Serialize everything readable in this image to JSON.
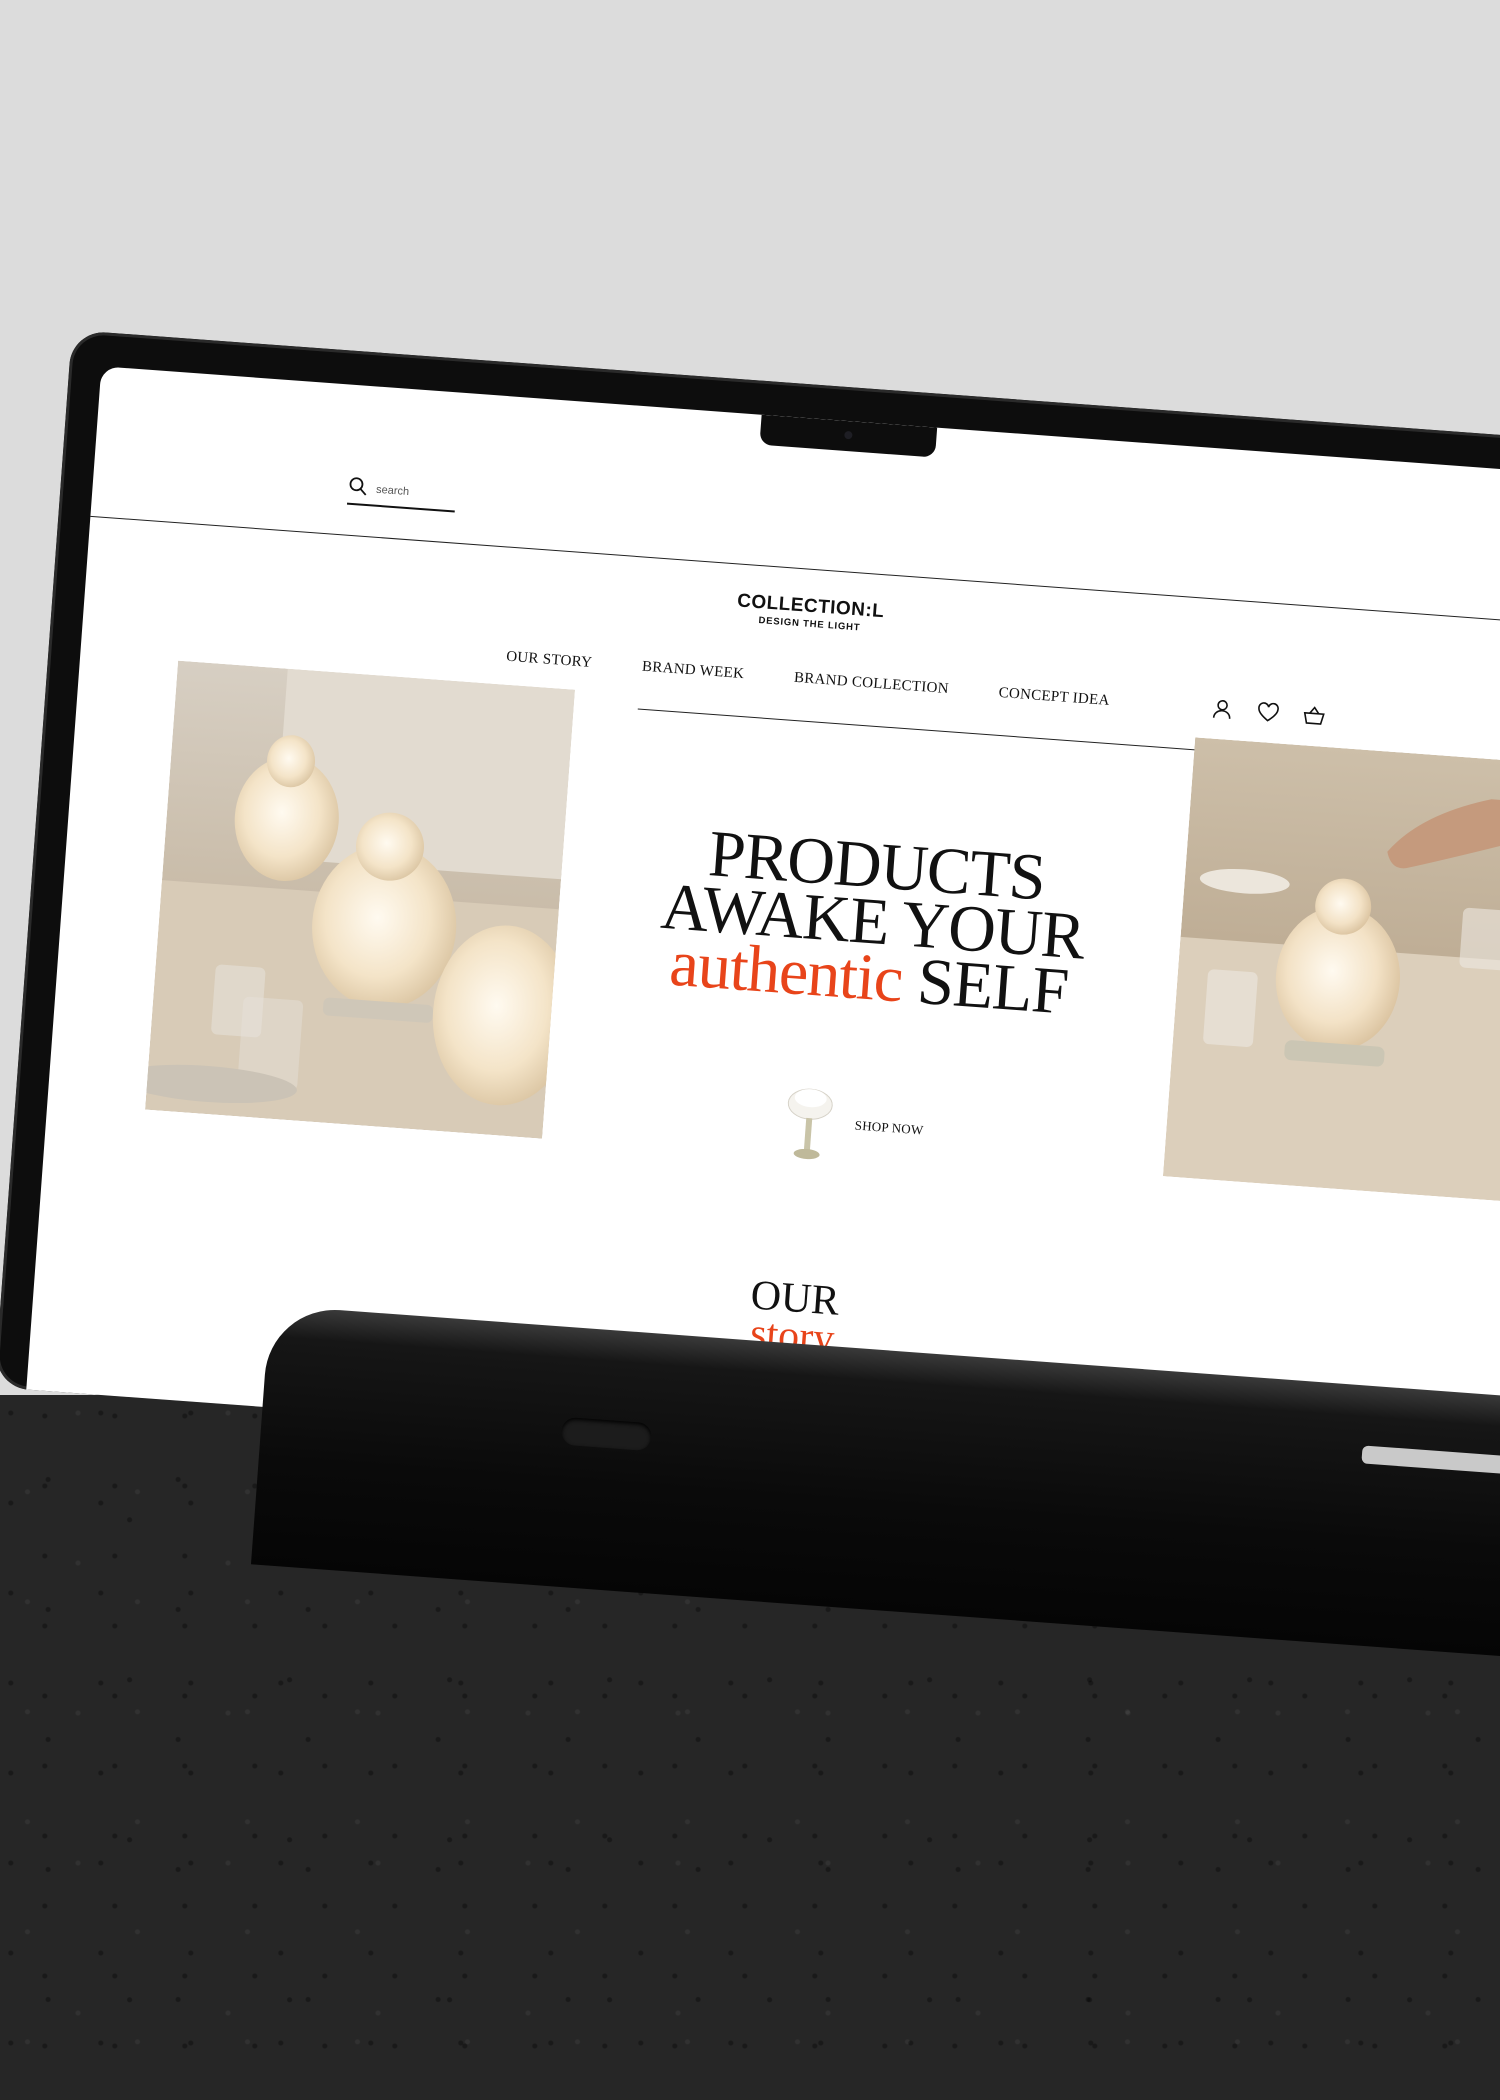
{
  "header": {
    "search_placeholder": "search",
    "logo_title": "COLLECTION:L",
    "logo_tagline": "DESIGN THE LIGHT"
  },
  "nav": {
    "items": [
      "OUR STORY",
      "BRAND WEEK",
      "BRAND COLLECTION",
      "CONCEPT IDEA"
    ]
  },
  "icons": {
    "search": "search-icon",
    "account": "user-icon",
    "wishlist": "heart-icon",
    "cart": "basket-icon"
  },
  "hero": {
    "line1": "PRODUCTS",
    "line2": "AWAKE YOUR",
    "accent_word": "authentic",
    "line3_end": "SELF",
    "cta": "SHOP NOW"
  },
  "story": {
    "title": "OUR",
    "subtitle": "story"
  },
  "colors": {
    "accent": "#e8441a",
    "text": "#111111",
    "background": "#ffffff"
  }
}
